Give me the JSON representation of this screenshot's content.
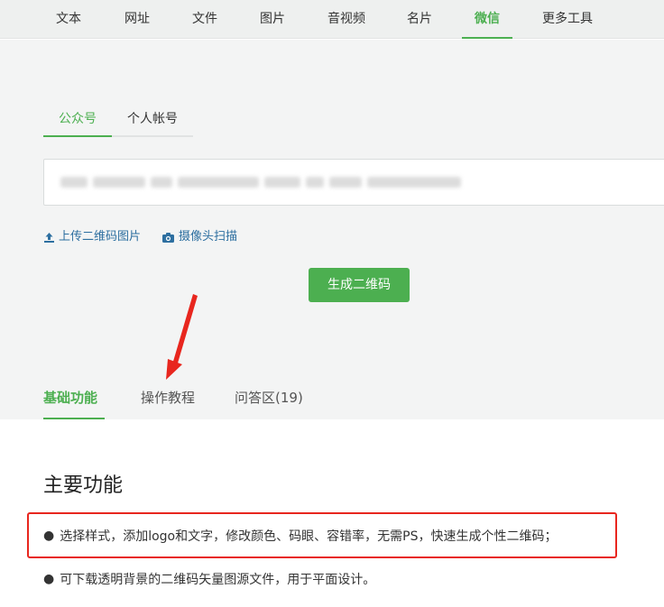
{
  "nav": {
    "items": [
      {
        "label": "文本"
      },
      {
        "label": "网址"
      },
      {
        "label": "文件"
      },
      {
        "label": "图片"
      },
      {
        "label": "音视频"
      },
      {
        "label": "名片"
      },
      {
        "label": "微信"
      },
      {
        "label": "更多工具"
      }
    ],
    "active_index": 6
  },
  "subtabs": {
    "official": "公众号",
    "personal": "个人帐号"
  },
  "tools": {
    "upload": "上传二维码图片",
    "camera": "摄像头扫描"
  },
  "generate_button": "生成二维码",
  "bottom_tabs": {
    "basic": "基础功能",
    "tutorial": "操作教程",
    "qa": "问答区(19)"
  },
  "main": {
    "title": "主要功能",
    "features": [
      "选择样式，添加logo和文字，修改颜色、码眼、容错率，无需PS，快速生成个性二维码；",
      "可下载透明背景的二维码矢量图源文件，用于平面设计。"
    ],
    "bullet": "●"
  },
  "colors": {
    "accent": "#4caf50",
    "link": "#2d6fa0",
    "highlight": "#e8261e"
  }
}
